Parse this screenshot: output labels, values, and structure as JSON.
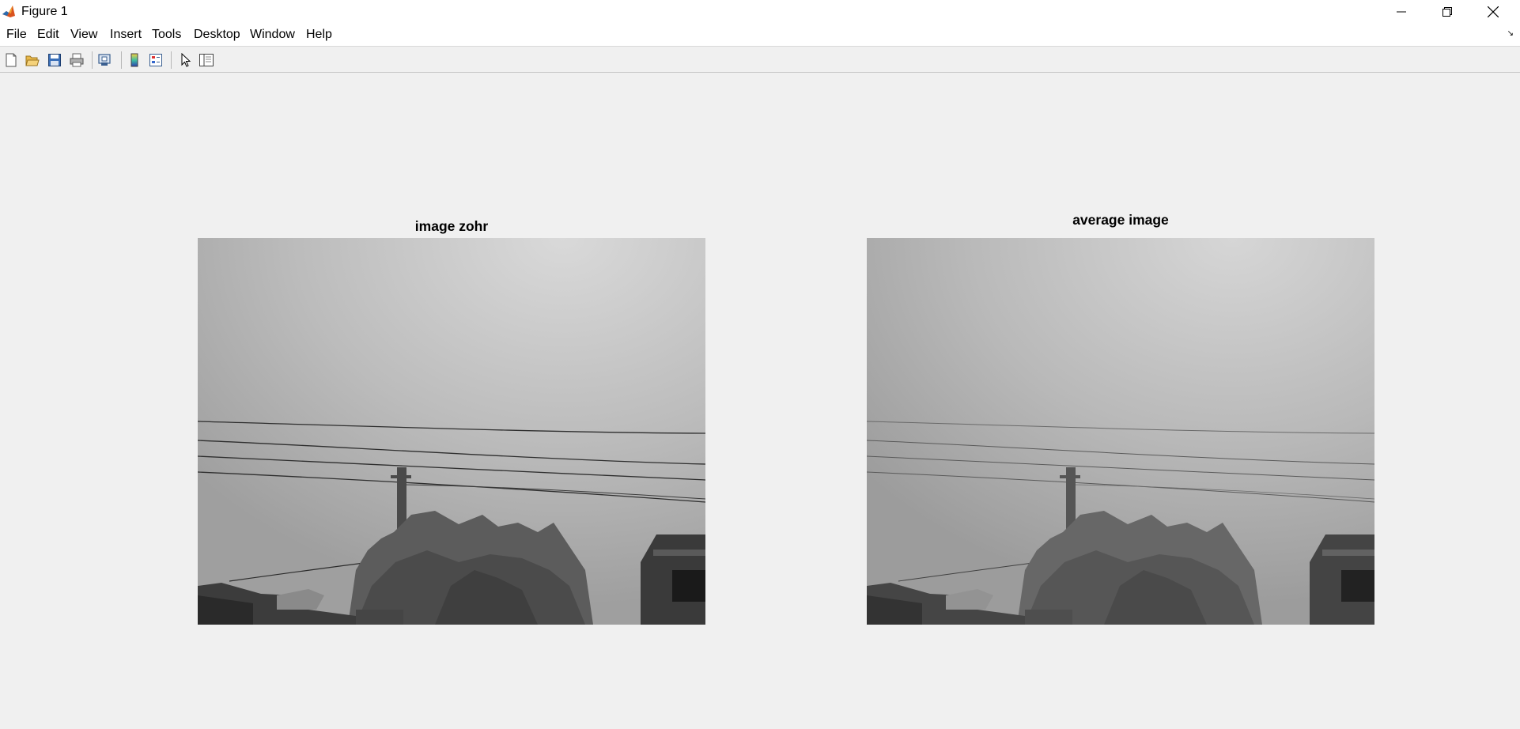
{
  "window": {
    "title": "Figure 1",
    "controls": [
      "minimize",
      "restore",
      "close"
    ]
  },
  "menu": {
    "items": [
      "File",
      "Edit",
      "View",
      "Insert",
      "Tools",
      "Desktop",
      "Window",
      "Help"
    ]
  },
  "toolbar": {
    "buttons": [
      {
        "icon": "new-figure-icon"
      },
      {
        "icon": "open-file-icon"
      },
      {
        "icon": "save-icon"
      },
      {
        "icon": "print-icon"
      },
      {
        "icon": "link-plot-icon"
      },
      {
        "icon": "colorbar-icon"
      },
      {
        "icon": "legend-icon"
      },
      {
        "icon": "pointer-icon"
      },
      {
        "icon": "property-editor-icon"
      }
    ]
  },
  "figure": {
    "background": "#f0f0f0",
    "axes": [
      {
        "title": "image zohr",
        "image": "grayscale-photo-sky-power-lines-trees"
      },
      {
        "title": "average image",
        "image": "grayscale-photo-sky-power-lines-trees-averaged"
      }
    ]
  }
}
